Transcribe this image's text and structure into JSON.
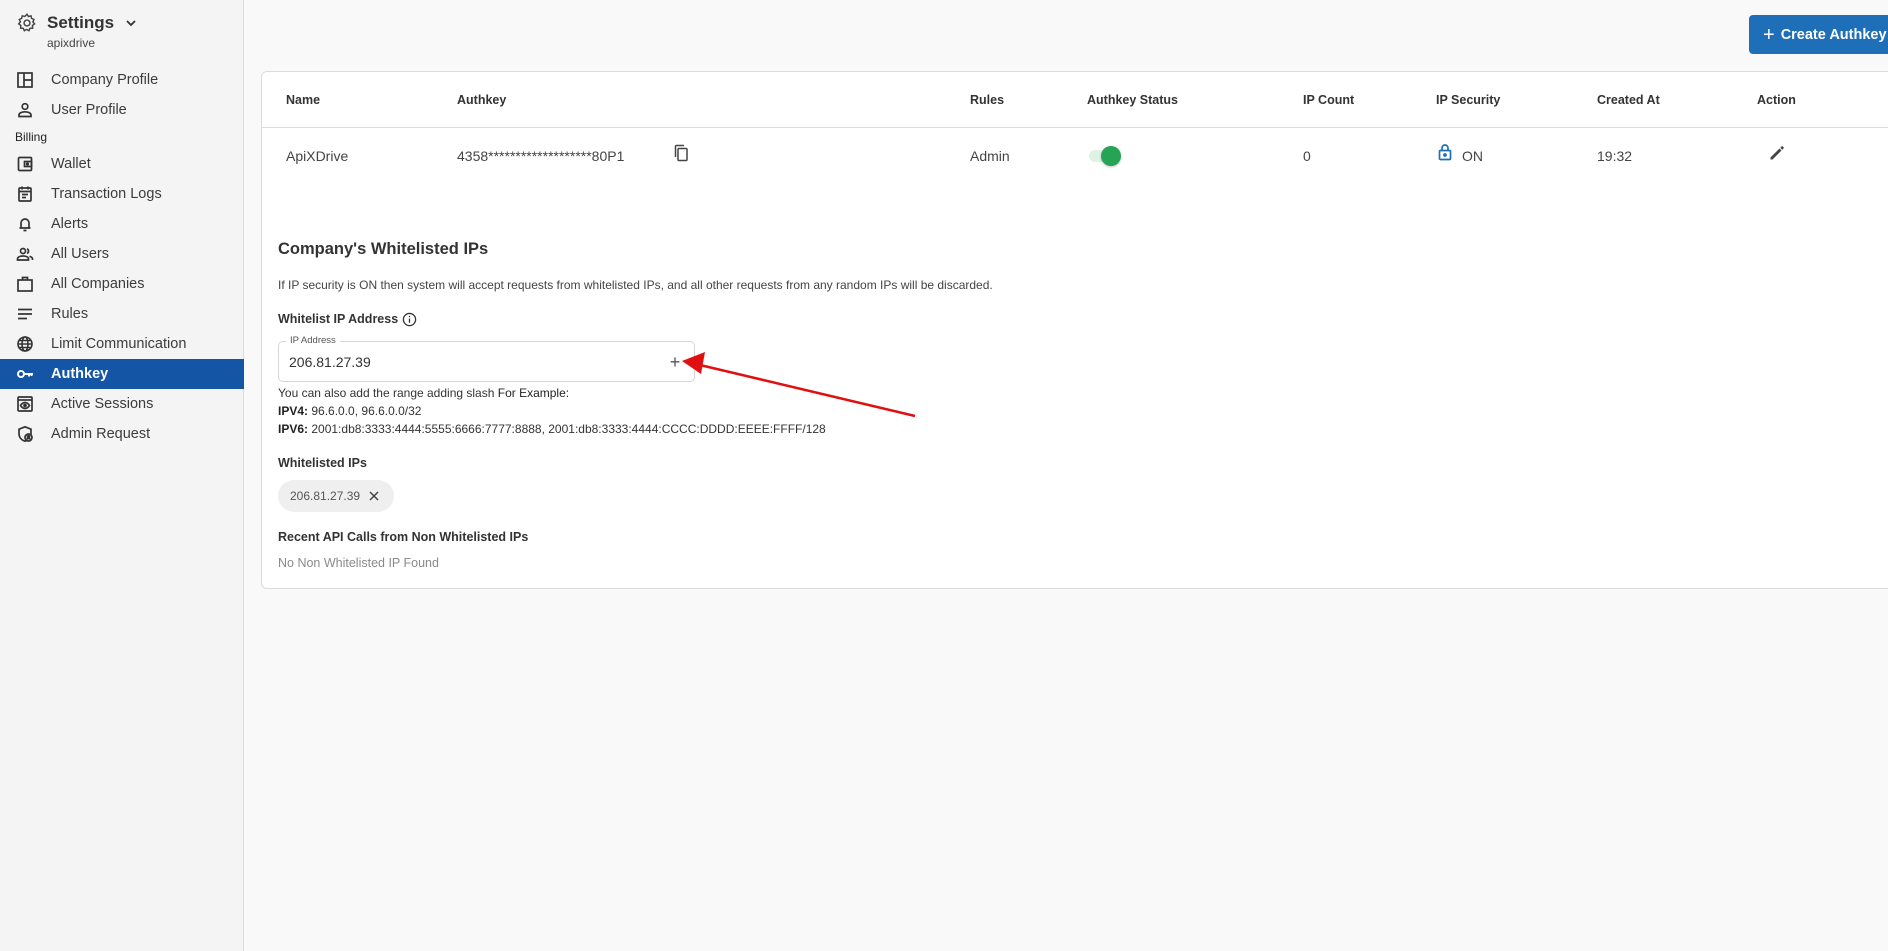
{
  "sidebar": {
    "title": "Settings",
    "subtitle": "apixdrive",
    "items": [
      {
        "label": "Company Profile",
        "icon": "layout-icon"
      },
      {
        "label": "User Profile",
        "icon": "person-icon"
      }
    ],
    "section_billing": "Billing",
    "billing_items": [
      {
        "label": "Wallet",
        "icon": "wallet-icon"
      },
      {
        "label": "Transaction Logs",
        "icon": "calendar-list-icon"
      },
      {
        "label": "Alerts",
        "icon": "bell-icon"
      },
      {
        "label": "All Users",
        "icon": "users-icon"
      },
      {
        "label": "All Companies",
        "icon": "briefcase-icon"
      },
      {
        "label": "Rules",
        "icon": "lines-icon"
      },
      {
        "label": "Limit Communication",
        "icon": "globe-icon"
      },
      {
        "label": "Authkey",
        "icon": "key-icon",
        "active": true
      },
      {
        "label": "Active Sessions",
        "icon": "eye-window-icon"
      },
      {
        "label": "Admin Request",
        "icon": "shield-user-icon"
      }
    ]
  },
  "toolbar": {
    "create_label": "Create Authkey",
    "create_icon": "+"
  },
  "table": {
    "headers": [
      "Name",
      "Authkey",
      "Rules",
      "Authkey Status",
      "IP Count",
      "IP Security",
      "Created At",
      "Action"
    ],
    "rows": [
      {
        "name": "ApiXDrive",
        "authkey": "4358*******************80P1",
        "rules": "Admin",
        "status_on": true,
        "ip_count": "0",
        "ip_security": "ON",
        "created_at": "19:32"
      }
    ]
  },
  "whitelist": {
    "title": "Company's Whitelisted IPs",
    "description": "If IP security is ON then system will accept requests from whitelisted IPs, and all other requests from any random IPs will be discarded.",
    "field_label": "Whitelist IP Address",
    "input_legend": "IP Address",
    "input_value": "206.81.27.39",
    "add_icon": "+",
    "hint_line": "You can also add the range adding slash",
    "hint_example": "For Example:",
    "ipv4_label": "IPV4:",
    "ipv4_examples": "96.6.0.0, 96.6.0.0/32",
    "ipv6_label": "IPV6:",
    "ipv6_examples": "2001:db8:3333:4444:5555:6666:7777:8888, 2001:db8:3333:4444:CCCC:DDDD:EEEE:FFFF/128",
    "list_label": "Whitelisted IPs",
    "ips": [
      "206.81.27.39"
    ],
    "recent_label": "Recent API Calls from Non Whitelisted IPs",
    "recent_empty": "No Non Whitelisted IP Found"
  },
  "colors": {
    "accent": "#1456a5",
    "button": "#1f6fb8",
    "toggle_on": "#27a355",
    "lock": "#1f6fb8",
    "annotation_arrow": "#e01010"
  }
}
